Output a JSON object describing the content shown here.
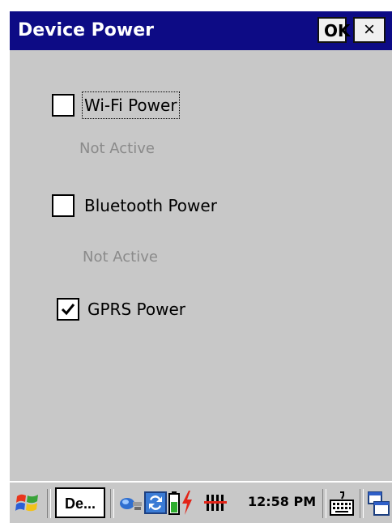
{
  "title_bar": {
    "title": "Device Power",
    "ok_label": "OK",
    "close_label": "×"
  },
  "options": [
    {
      "label": "Wi-Fi Power",
      "checked": false,
      "status": "Not Active",
      "focused": true
    },
    {
      "label": "Bluetooth Power",
      "checked": false,
      "status": "Not Active",
      "focused": false
    },
    {
      "label": "GPRS Power",
      "checked": true,
      "status": "",
      "focused": false
    }
  ],
  "taskbar": {
    "start_icon": "windows-flag-icon",
    "task_button_label": "De...",
    "tray_icons": [
      "network-icon",
      "sync-icon",
      "battery-icon",
      "charging-icon",
      "signal-icon"
    ],
    "clock": "12:58 PM",
    "sip_icon": "keyboard-icon",
    "end_icon": "window-switch-icon"
  },
  "colors": {
    "title_bar": "#0d0b85",
    "content_bg": "#c8c8c8",
    "disabled_text": "#8a8a8a"
  }
}
